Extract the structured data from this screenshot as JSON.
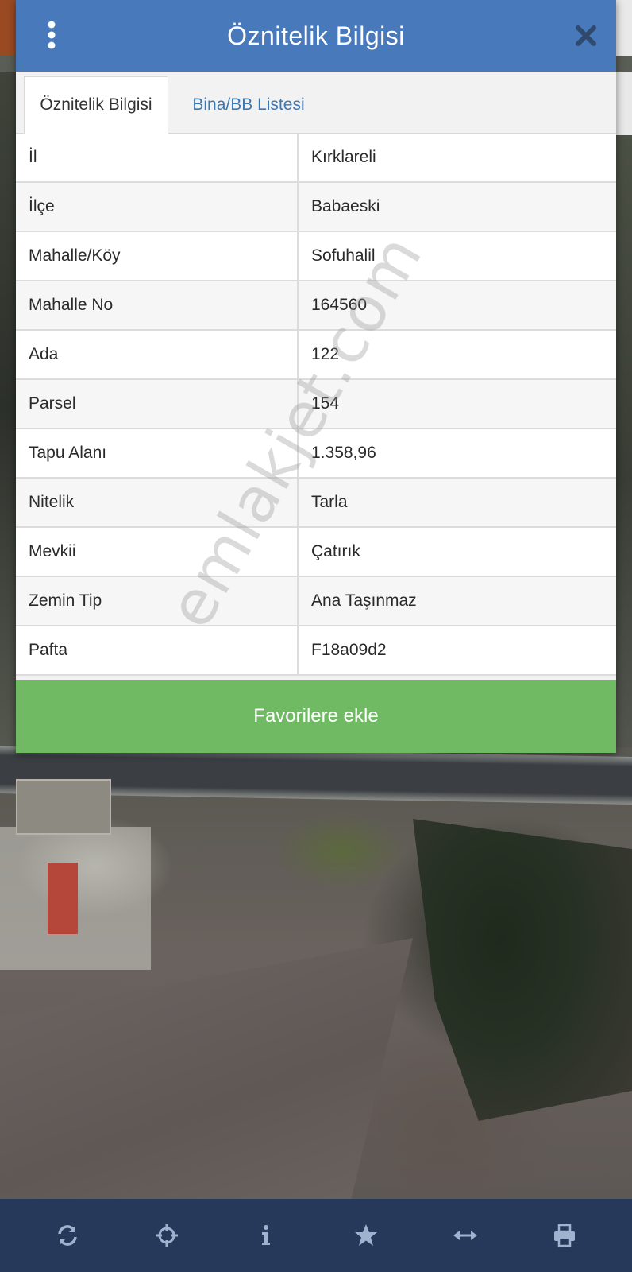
{
  "dialog": {
    "title": "Öznitelik Bilgisi",
    "tabs": [
      {
        "label": "Öznitelik Bilgisi",
        "active": true
      },
      {
        "label": "Bina/BB Listesi",
        "active": false
      }
    ],
    "rows": [
      {
        "key": "İl",
        "value": "Kırklareli"
      },
      {
        "key": "İlçe",
        "value": "Babaeski"
      },
      {
        "key": "Mahalle/Köy",
        "value": "Sofuhalil"
      },
      {
        "key": "Mahalle No",
        "value": "164560"
      },
      {
        "key": "Ada",
        "value": "122"
      },
      {
        "key": "Parsel",
        "value": "154"
      },
      {
        "key": "Tapu Alanı",
        "value": "1.358,96"
      },
      {
        "key": "Nitelik",
        "value": "Tarla"
      },
      {
        "key": "Mevkii",
        "value": "Çatırık"
      },
      {
        "key": "Zemin Tip",
        "value": "Ana Taşınmaz"
      },
      {
        "key": "Pafta",
        "value": "F18a09d2"
      }
    ],
    "favorite_button": "Favorilere ekle"
  },
  "watermark": "emlakjet.com",
  "toolbar": {
    "icons": [
      "refresh-icon",
      "locate-icon",
      "info-icon",
      "star-icon",
      "measure-icon",
      "print-icon"
    ]
  },
  "colors": {
    "header": "#4879bb",
    "tab_link": "#3a78b5",
    "favorite_button": "#6fba63",
    "toolbar": "#27395a"
  }
}
